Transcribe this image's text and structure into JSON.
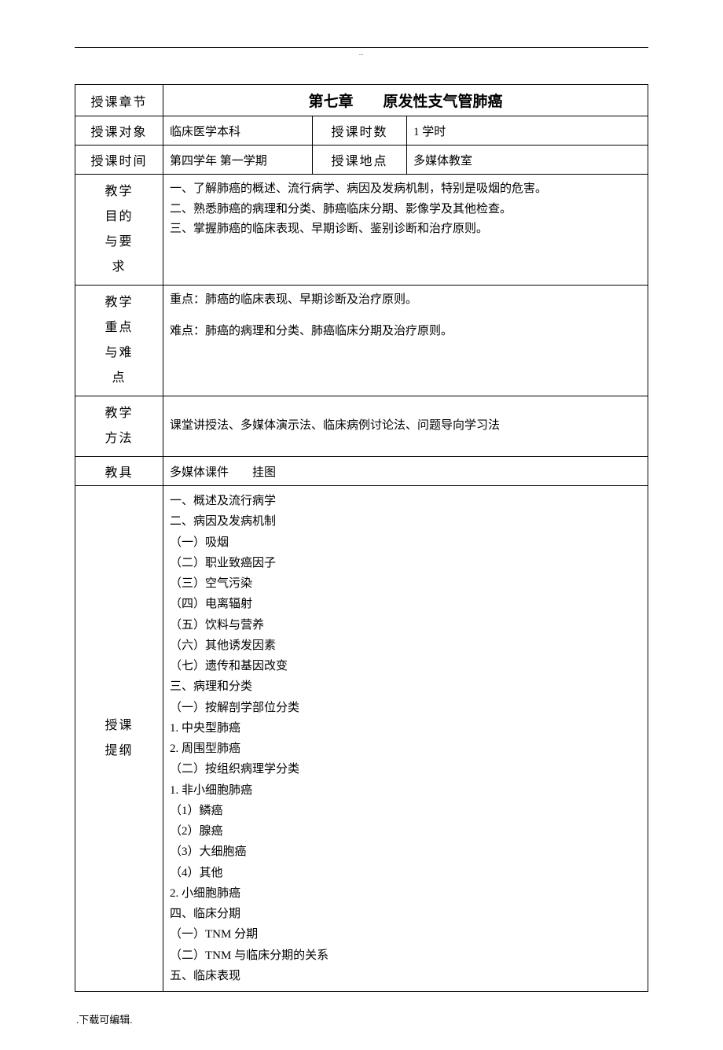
{
  "header_dots": "..",
  "rows": {
    "chapter_label": "授课章节",
    "chapter_title": "第七章　　原发性支气管肺癌",
    "audience_label": "授课对象",
    "audience_value": "临床医学本科",
    "hours_label": "授课时数",
    "hours_value": "1 学时",
    "time_label": "授课时间",
    "time_value": "第四学年 第一学期",
    "location_label": "授课地点",
    "location_value": "多媒体教室"
  },
  "objectives": {
    "label_lines": [
      "教学",
      "目的",
      "与要",
      "求"
    ],
    "content": [
      "一、了解肺癌的概述、流行病学、病因及发病机制，特别是吸烟的危害。",
      "二、熟悉肺癌的病理和分类、肺癌临床分期、影像学及其他检查。",
      "三、掌握肺癌的临床表现、早期诊断、鉴别诊断和治疗原则。"
    ]
  },
  "keypoints": {
    "label_lines": [
      "教学",
      "重点",
      "与难",
      "点"
    ],
    "key": "重点：肺癌的临床表现、早期诊断及治疗原则。",
    "difficult": "难点：肺癌的病理和分类、肺癌临床分期及治疗原则。"
  },
  "methods": {
    "label_lines": [
      "教学",
      "方法"
    ],
    "content": "课堂讲授法、多媒体演示法、临床病例讨论法、问题导向学习法"
  },
  "tools": {
    "label": "教具",
    "content": "多媒体课件　　挂图"
  },
  "outline": {
    "label_lines": [
      "授课",
      "提纲"
    ],
    "items": [
      "一、概述及流行病学",
      "二、病因及发病机制",
      "（一）吸烟",
      "（二）职业致癌因子",
      "（三）空气污染",
      "（四）电离辐射",
      "（五）饮料与营养",
      "（六）其他诱发因素",
      "（七）遗传和基因改变",
      "三、病理和分类",
      "（一）按解剖学部位分类",
      "1. 中央型肺癌",
      "2. 周围型肺癌",
      "（二）按组织病理学分类",
      "1. 非小细胞肺癌",
      "（1）鳞癌",
      "（2）腺癌",
      "（3）大细胞癌",
      "（4）其他",
      "2. 小细胞肺癌",
      "四、临床分期",
      "（一）TNM 分期",
      "（二）TNM 与临床分期的关系",
      "五、临床表现"
    ]
  },
  "footer": ".下载可编辑."
}
